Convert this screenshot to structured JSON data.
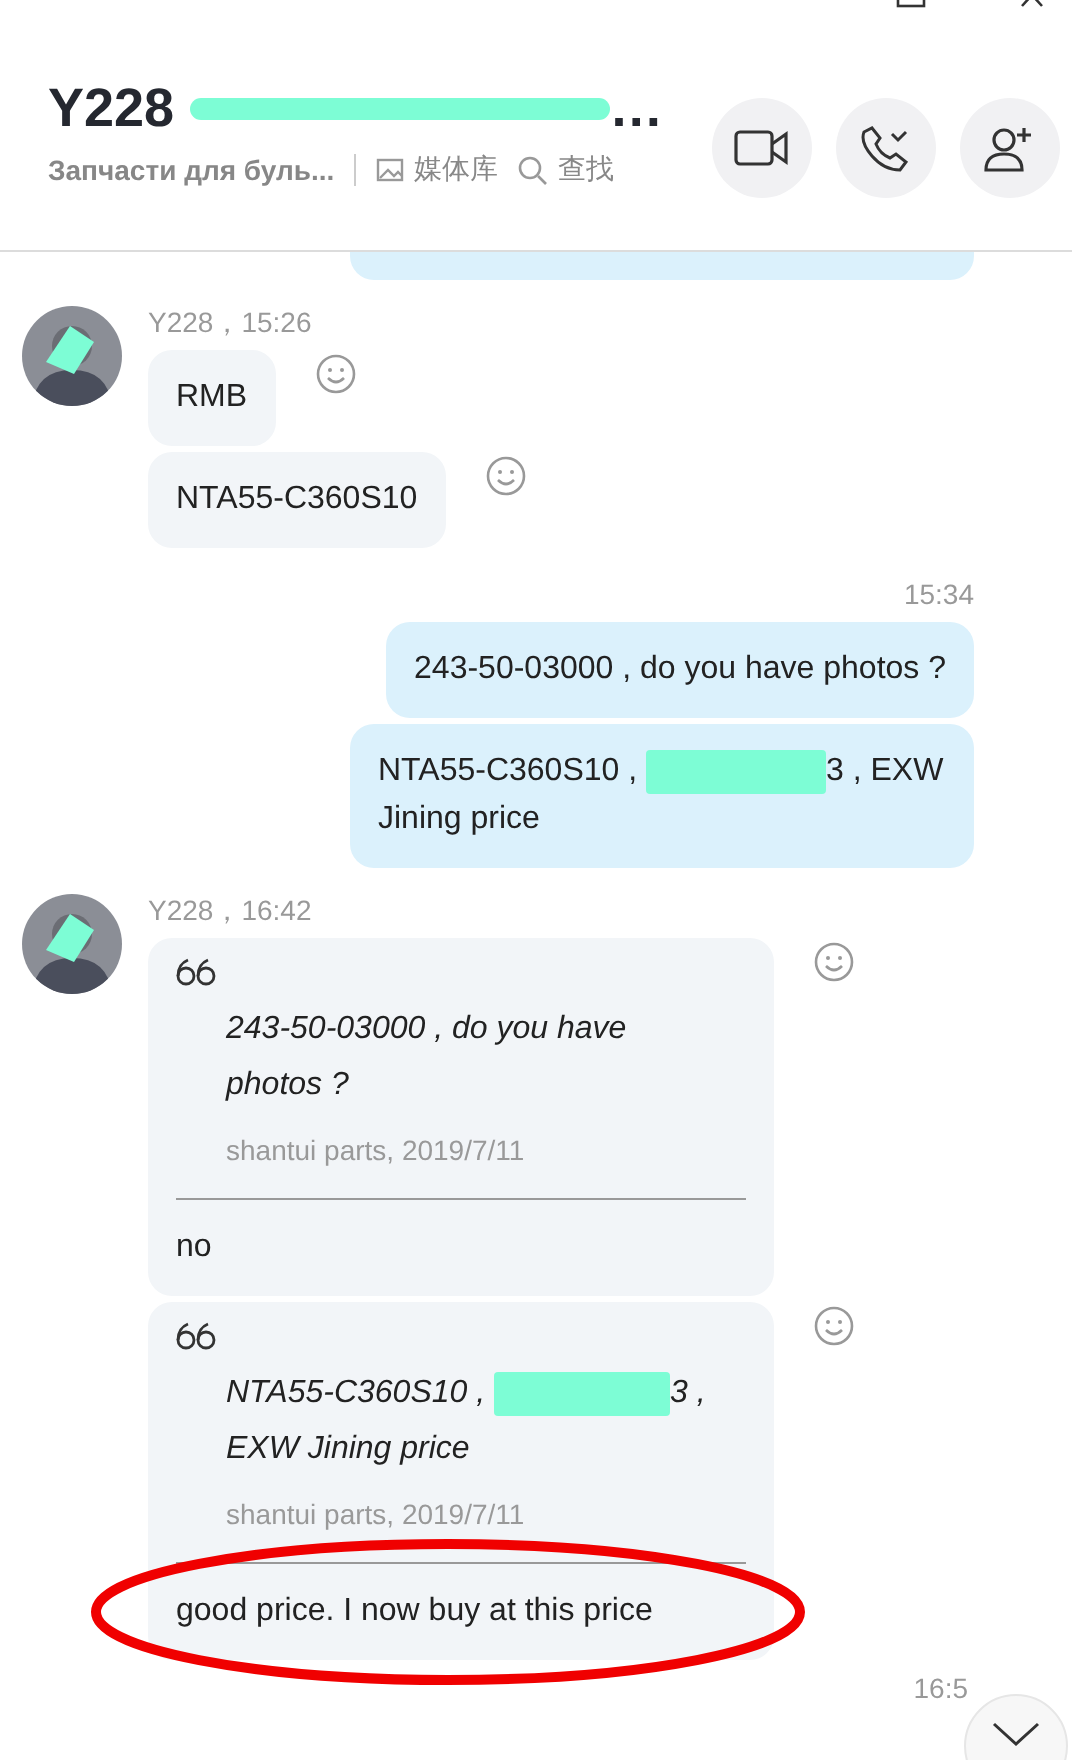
{
  "header": {
    "title_parts": [
      {
        "kind": "text",
        "text": "Y228 "
      },
      {
        "kind": "redacted"
      },
      {
        "kind": "text",
        "text": "…"
      }
    ],
    "subtitle": "Запчасти для буль...",
    "links": [
      {
        "kind": "media",
        "label": "媒体库"
      },
      {
        "kind": "search",
        "label": "查找"
      }
    ],
    "actions": [
      {
        "kind": "video"
      },
      {
        "kind": "call"
      },
      {
        "kind": "add-person"
      }
    ]
  },
  "messages": [
    {
      "kind": "partial",
      "outgoing": true
    },
    {
      "kind": "group",
      "outgoing": false,
      "sender": "Y228，15:26",
      "bubbles": [
        {
          "parts": [
            {
              "kind": "text",
              "text": "RMB"
            }
          ]
        },
        {
          "parts": [
            {
              "kind": "text",
              "text": "NTA55-C360S10"
            }
          ]
        }
      ]
    },
    {
      "kind": "group",
      "outgoing": true,
      "time": "15:34",
      "bubbles": [
        {
          "parts": [
            {
              "kind": "text",
              "text": "243-50-03000 , do you have photos ?"
            }
          ]
        },
        {
          "parts": [
            {
              "kind": "text",
              "text": "NTA55-C360S10 , "
            },
            {
              "kind": "redacted"
            },
            {
              "kind": "text",
              "text": "3 , EXW Jining price"
            }
          ]
        }
      ]
    },
    {
      "kind": "group",
      "outgoing": false,
      "sender": "Y228，16:42",
      "bubbles": [
        {
          "quote": {
            "parts": [
              {
                "kind": "text",
                "text": "243-50-03000 , do you have photos ?"
              }
            ],
            "source": "shantui parts, 2019/7/11"
          },
          "parts": [
            {
              "kind": "text",
              "text": "no"
            }
          ],
          "circled": false
        },
        {
          "quote": {
            "parts": [
              {
                "kind": "text",
                "text": "NTA55-C360S10 , "
              },
              {
                "kind": "redacted"
              },
              {
                "kind": "text",
                "text": "3 , EXW Jining price"
              }
            ],
            "source": "shantui parts, 2019/7/11"
          },
          "parts": [
            {
              "kind": "text",
              "text": "good price. I now buy at this price"
            }
          ],
          "circled": true
        }
      ]
    },
    {
      "kind": "time-only",
      "time": "16:5"
    }
  ]
}
